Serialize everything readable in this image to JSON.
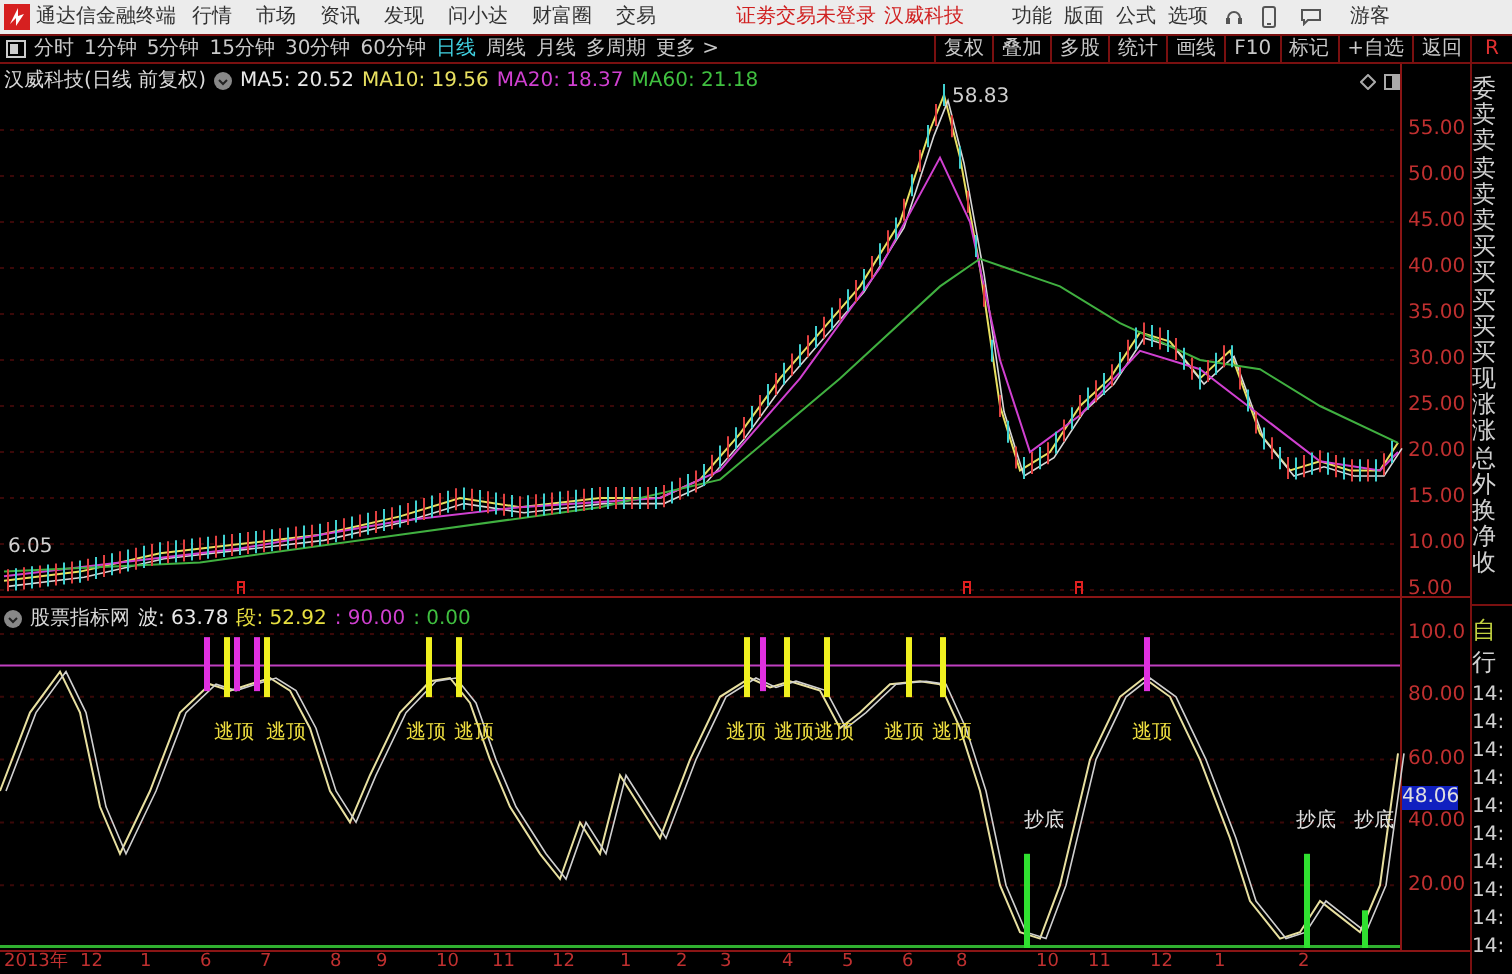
{
  "title_bar": {
    "app_name": "通达信金融终端",
    "menu": [
      "行情",
      "市场",
      "资讯",
      "发现",
      "问小达",
      "财富圈",
      "交易"
    ],
    "login_status": "证劵交易未登录",
    "stock_name": "汉威科技",
    "right_menu": [
      "功能",
      "版面",
      "公式",
      "选项"
    ],
    "user": "游客"
  },
  "period_tabs": [
    {
      "label": "分时",
      "selected": false
    },
    {
      "label": "1分钟",
      "selected": false
    },
    {
      "label": "5分钟",
      "selected": false
    },
    {
      "label": "15分钟",
      "selected": false
    },
    {
      "label": "30分钟",
      "selected": false
    },
    {
      "label": "60分钟",
      "selected": false
    },
    {
      "label": "日线",
      "selected": true
    },
    {
      "label": "周线",
      "selected": false
    },
    {
      "label": "月线",
      "selected": false
    },
    {
      "label": "多周期",
      "selected": false
    },
    {
      "label": "更多 >",
      "selected": false
    }
  ],
  "tools": [
    "复权",
    "叠加",
    "多股",
    "统计",
    "画线",
    "F10",
    "标记",
    "+自选",
    "返回"
  ],
  "toolbar_right": "R",
  "price_panel": {
    "title": "汉威科技(日线 前复权)",
    "ma": [
      {
        "label": "MA5: 20.52",
        "color": "#e8e8e8"
      },
      {
        "label": "MA10: 19.56",
        "color": "#e8e060"
      },
      {
        "label": "MA20: 18.37",
        "color": "#d040d0"
      },
      {
        "label": "MA60: 21.18",
        "color": "#40c040"
      }
    ],
    "high_label": "58.83",
    "low_label": "6.05",
    "axis": [
      "55.00",
      "50.00",
      "45.00",
      "40.00",
      "35.00",
      "30.00",
      "25.00",
      "20.00",
      "15.00",
      "10.00",
      "5.00"
    ]
  },
  "indicator_panel": {
    "title": "股票指标网",
    "values": [
      {
        "label": "波: 63.78",
        "color": "#e8e8e8"
      },
      {
        "label": "段: 52.92",
        "color": "#e8e040"
      },
      {
        "label": ": 90.00",
        "color": "#d040d0"
      },
      {
        "label": ": 0.00",
        "color": "#40c040"
      }
    ],
    "signals": [
      {
        "kind": "top",
        "label": "逃顶"
      },
      {
        "kind": "top",
        "label": "逃顶"
      },
      {
        "kind": "top",
        "label": "逃顶"
      },
      {
        "kind": "top",
        "label": "逃顶"
      },
      {
        "kind": "top",
        "label": "逃顶"
      },
      {
        "kind": "top",
        "label": "逃顶"
      },
      {
        "kind": "top",
        "label": "逃顶"
      },
      {
        "kind": "top",
        "label": "逃顶"
      },
      {
        "kind": "top",
        "label": "逃顶"
      },
      {
        "kind": "top",
        "label": "逃顶"
      },
      {
        "kind": "bottom",
        "label": "抄底"
      },
      {
        "kind": "bottom",
        "label": "抄底"
      },
      {
        "kind": "bottom",
        "label": "抄底"
      }
    ],
    "axis": [
      "100.0",
      "80.00",
      "60.00",
      "40.00",
      "20.00"
    ],
    "current_value": "48.06"
  },
  "date_axis": [
    "2013年",
    "12",
    "1",
    "6",
    "7",
    "8",
    "9",
    "10",
    "11",
    "12",
    "1",
    "2",
    "3",
    "4",
    "5",
    "6",
    "8",
    "10",
    "11",
    "12",
    "1",
    "2"
  ],
  "quote_panel": {
    "labels": [
      "委",
      "卖",
      "卖",
      "卖",
      "卖",
      "卖",
      "买",
      "买",
      "买",
      "买",
      "买",
      "现",
      "涨",
      "涨",
      "总",
      "外",
      "换",
      "净",
      "收"
    ],
    "mode": "自",
    "quotes": "行",
    "times": [
      "14:",
      "14:",
      "14:",
      "14:",
      "14:",
      "14:",
      "14:",
      "14:",
      "14:",
      "14:"
    ]
  }
}
